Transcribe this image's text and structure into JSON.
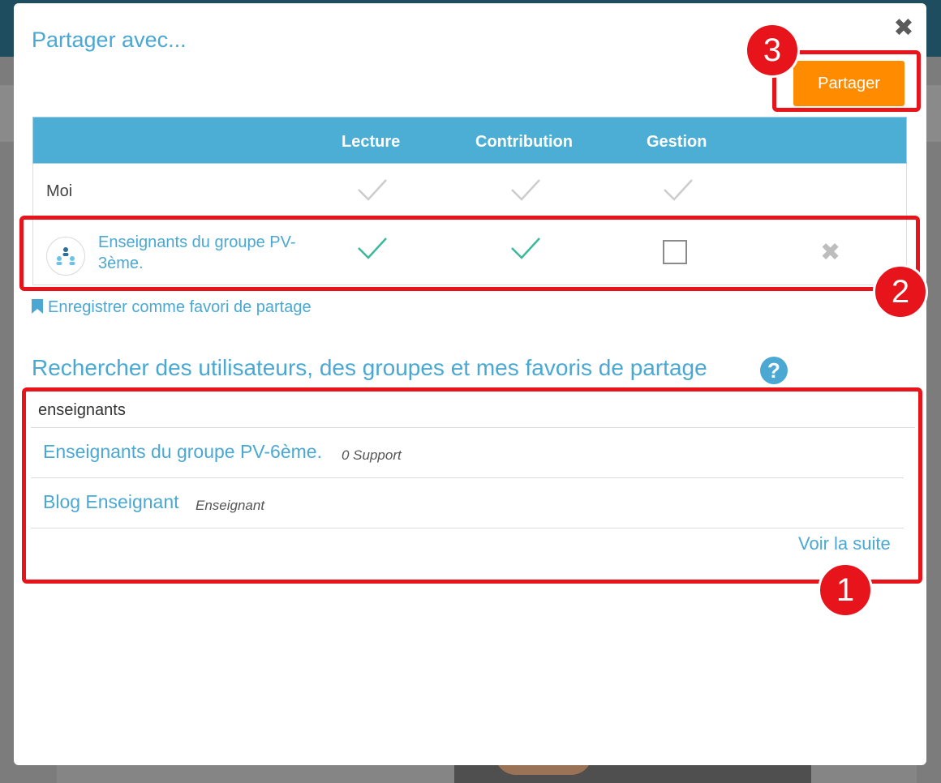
{
  "modal": {
    "title": "Partager avec...",
    "share_button": "Partager",
    "close_icon": "close-icon"
  },
  "table": {
    "headers": [
      "Lecture",
      "Contribution",
      "Gestion"
    ],
    "rows": [
      {
        "label": "Moi",
        "lecture": true,
        "contribution": true,
        "gestion": true,
        "enabled": false
      },
      {
        "label": "Enseignants du groupe PV-3ème.",
        "lecture": true,
        "contribution": true,
        "gestion": false,
        "enabled": true
      }
    ]
  },
  "favori_link": "Enregistrer comme favori de partage",
  "search": {
    "title": "Rechercher des utilisateurs, des groupes et mes favoris de partage",
    "value": "enseignants",
    "results": [
      {
        "name": "Enseignants du groupe PV-6ème.",
        "meta": "0 Support"
      },
      {
        "name": "Blog Enseignant",
        "meta": "Enseignant"
      }
    ],
    "see_more": "Voir la suite"
  },
  "annotations": [
    "1",
    "2",
    "3"
  ],
  "colors": {
    "accent": "#4aa8d2",
    "header_bg": "#4caed4",
    "share_button": "#ff8c00",
    "highlight": "#e8141c",
    "check_active": "#3bb89a",
    "check_inactive": "#cccccc"
  }
}
